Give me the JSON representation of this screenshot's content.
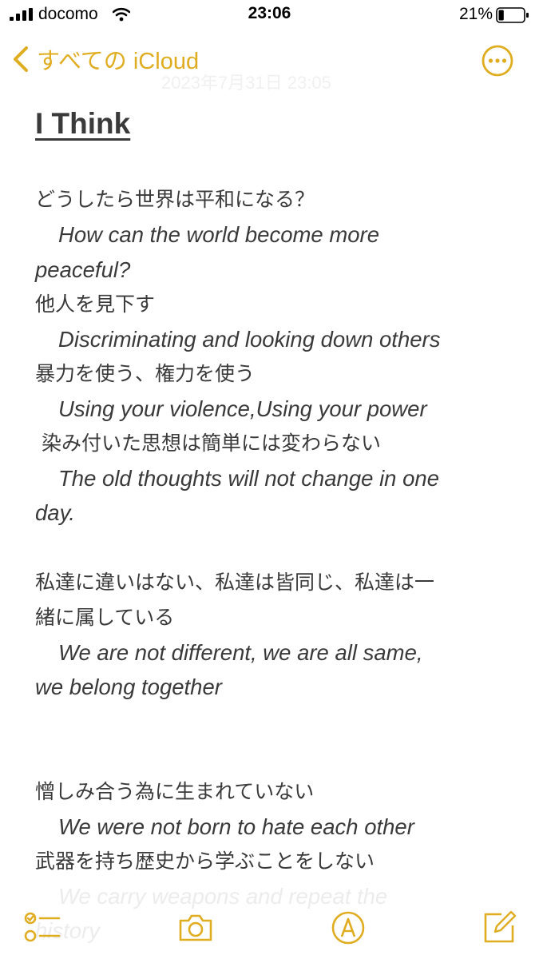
{
  "status_bar": {
    "carrier": "docomo",
    "time": "23:06",
    "battery_percent": "21%",
    "battery_level": 0.21
  },
  "nav": {
    "back_label": "すべての iCloud",
    "date": "2023年7月31日 23:05",
    "accent_color": "#e0ac20"
  },
  "note": {
    "title": "I Think",
    "lines": [
      "どうしたら世界は平和になる？",
      "How can the world become more",
      "peaceful?",
      "他人を見下す",
      "Discriminating and looking down others",
      "暴力を使う、権力を使う",
      "Using your violence,Using your power",
      " 染み付いた思想は簡単には変わらない",
      "The old thoughts will not change in one",
      "day.",
      "私達に違いはない、私達は皆同じ、私達は一",
      "緒に属している",
      "We are not different, we are all same,",
      "we belong together",
      "憎しみ合う為に生まれていない",
      "We were not born to hate each other",
      "武器を持ち歴史から学ぶことをしない",
      "We carry weapons and repeat the",
      "history"
    ]
  },
  "toolbar": {
    "icons": [
      "checklist-icon",
      "camera-icon",
      "markup-icon",
      "compose-icon"
    ]
  }
}
